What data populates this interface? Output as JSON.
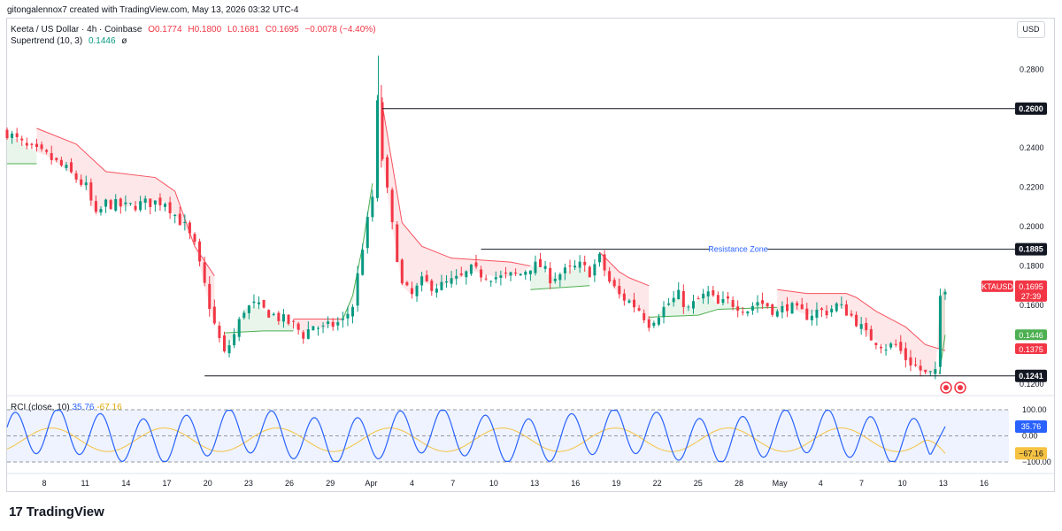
{
  "header": {
    "created_by": "gitongalennox7 created with TradingView.com, May 13, 2026 03:32 UTC-4"
  },
  "legend": {
    "symbol": "Keeta / US Dollar · 4h · Coinbase",
    "open": "O0.1774",
    "high": "H0.1800",
    "low": "L0.1681",
    "close": "C0.1695",
    "change": "−0.0078 (−4.40%)",
    "supertrend_label": "Supertrend (10, 3)",
    "supertrend_value": "0.1446",
    "supertrend_symbol": "ø"
  },
  "rci_legend": {
    "label": "RCI (close, 10)",
    "value1": "35.76",
    "value2": "-67.16"
  },
  "currency": "USD",
  "brand": {
    "logo_text": "17",
    "name": "TradingView"
  },
  "colors": {
    "up": "#089981",
    "down": "#f23645",
    "st_up": "#4caf50",
    "st_down": "#f7525f",
    "rci": "#2962ff",
    "rci_signal": "#f5c242"
  },
  "chart_data": {
    "type": "candlestick",
    "ylim": [
      0.115,
      0.295
    ],
    "price_ticks": [
      "0.2800",
      "0.2400",
      "0.2200",
      "0.2000",
      "0.1800",
      "0.1600",
      "0.1200"
    ],
    "price_tick_values": [
      0.28,
      0.24,
      0.22,
      0.2,
      0.18,
      0.16,
      0.12
    ],
    "x_ticks": [
      "8",
      "11",
      "14",
      "17",
      "20",
      "23",
      "26",
      "29",
      "Apr",
      "4",
      "7",
      "10",
      "13",
      "16",
      "19",
      "22",
      "25",
      "28",
      "May",
      "4",
      "7",
      "10",
      "13",
      "16"
    ],
    "horizontal_levels": [
      {
        "value": 0.26,
        "label": "0.2600",
        "start": 38
      },
      {
        "value": 0.1885,
        "label": "0.1885",
        "start": 48,
        "annotation": "Resistance Zone"
      },
      {
        "value": 0.1241,
        "label": "0.1241",
        "start": 20
      }
    ],
    "price_labels": [
      {
        "value": 0.1695,
        "label": "0.1695",
        "sublabel": "27:39",
        "tag": "KTAUSD",
        "color": "#f23645"
      },
      {
        "value": 0.1446,
        "label": "0.1446",
        "color": "#4caf50"
      },
      {
        "value": 0.1375,
        "label": "0.1375",
        "color": "#f23645"
      }
    ],
    "price_path": [
      [
        0,
        0.248
      ],
      [
        2,
        0.24
      ],
      [
        4,
        0.236
      ],
      [
        6,
        0.229
      ],
      [
        8,
        0.22
      ],
      [
        9,
        0.205
      ],
      [
        10,
        0.212
      ],
      [
        12,
        0.21
      ],
      [
        14,
        0.212
      ],
      [
        16,
        0.213
      ],
      [
        17,
        0.206
      ],
      [
        18,
        0.2
      ],
      [
        19,
        0.19
      ],
      [
        20,
        0.17
      ],
      [
        21,
        0.15
      ],
      [
        22,
        0.135
      ],
      [
        23,
        0.145
      ],
      [
        24,
        0.158
      ],
      [
        25,
        0.16
      ],
      [
        27,
        0.155
      ],
      [
        29,
        0.15
      ],
      [
        30,
        0.145
      ],
      [
        31,
        0.15
      ],
      [
        32,
        0.148
      ],
      [
        33,
        0.15
      ],
      [
        34,
        0.152
      ],
      [
        35,
        0.16
      ],
      [
        36,
        0.19
      ],
      [
        37,
        0.215
      ],
      [
        37.5,
        0.262
      ],
      [
        38,
        0.235
      ],
      [
        39,
        0.2
      ],
      [
        40,
        0.17
      ],
      [
        41,
        0.165
      ],
      [
        42,
        0.172
      ],
      [
        43,
        0.17
      ],
      [
        44,
        0.17
      ],
      [
        45,
        0.172
      ],
      [
        46,
        0.174
      ],
      [
        47,
        0.178
      ],
      [
        48,
        0.176
      ],
      [
        50,
        0.174
      ],
      [
        52,
        0.176
      ],
      [
        53,
        0.18
      ],
      [
        54,
        0.18
      ],
      [
        55,
        0.174
      ],
      [
        56,
        0.176
      ],
      [
        57,
        0.178
      ],
      [
        58,
        0.18
      ],
      [
        59,
        0.177
      ],
      [
        60,
        0.184
      ],
      [
        61,
        0.172
      ],
      [
        62,
        0.165
      ],
      [
        63,
        0.162
      ],
      [
        64,
        0.158
      ],
      [
        65,
        0.151
      ],
      [
        66,
        0.156
      ],
      [
        67,
        0.161
      ],
      [
        68,
        0.165
      ],
      [
        69,
        0.158
      ],
      [
        70,
        0.163
      ],
      [
        71,
        0.166
      ],
      [
        72,
        0.16
      ],
      [
        73,
        0.162
      ],
      [
        74,
        0.16
      ],
      [
        75,
        0.158
      ],
      [
        76,
        0.162
      ],
      [
        77,
        0.16
      ],
      [
        78,
        0.156
      ],
      [
        79,
        0.16
      ],
      [
        80,
        0.157
      ],
      [
        81,
        0.155
      ],
      [
        82,
        0.157
      ],
      [
        83,
        0.157
      ],
      [
        84,
        0.16
      ],
      [
        85,
        0.157
      ],
      [
        86,
        0.152
      ],
      [
        87,
        0.145
      ],
      [
        88,
        0.142
      ],
      [
        89,
        0.139
      ],
      [
        90,
        0.14
      ],
      [
        91,
        0.133
      ],
      [
        92,
        0.129
      ],
      [
        93,
        0.125
      ],
      [
        94,
        0.125
      ],
      [
        94.4,
        0.16
      ],
      [
        94.8,
        0.178
      ],
      [
        95,
        0.1695
      ]
    ],
    "supertrend": [
      {
        "dir": "up",
        "points": [
          [
            0,
            0.232
          ],
          [
            3,
            0.232
          ]
        ]
      },
      {
        "dir": "down",
        "points": [
          [
            3,
            0.25
          ],
          [
            7,
            0.242
          ],
          [
            10,
            0.228
          ],
          [
            15,
            0.225
          ],
          [
            17,
            0.218
          ],
          [
            19,
            0.19
          ],
          [
            21,
            0.175
          ]
        ]
      },
      {
        "dir": "up",
        "points": [
          [
            22,
            0.146
          ],
          [
            26,
            0.147
          ],
          [
            29,
            0.147
          ]
        ]
      },
      {
        "dir": "down",
        "points": [
          [
            29,
            0.153
          ],
          [
            34,
            0.153
          ]
        ]
      },
      {
        "dir": "up",
        "points": [
          [
            34,
            0.153
          ],
          [
            35,
            0.165
          ],
          [
            36,
            0.19
          ],
          [
            37,
            0.222
          ]
        ]
      },
      {
        "dir": "down",
        "points": [
          [
            38,
            0.262
          ],
          [
            39,
            0.232
          ],
          [
            40,
            0.202
          ],
          [
            42,
            0.19
          ],
          [
            45,
            0.184
          ],
          [
            51,
            0.182
          ],
          [
            53,
            0.18
          ]
        ]
      },
      {
        "dir": "up",
        "points": [
          [
            53,
            0.168
          ],
          [
            59,
            0.17
          ]
        ]
      },
      {
        "dir": "down",
        "points": [
          [
            60,
            0.187
          ],
          [
            62,
            0.177
          ],
          [
            63,
            0.174
          ],
          [
            65,
            0.17
          ]
        ]
      },
      {
        "dir": "up",
        "points": [
          [
            65,
            0.154
          ],
          [
            70,
            0.155
          ],
          [
            72,
            0.158
          ],
          [
            78,
            0.159
          ]
        ]
      },
      {
        "dir": "down",
        "points": [
          [
            78,
            0.168
          ],
          [
            81,
            0.166
          ],
          [
            85,
            0.166
          ],
          [
            86,
            0.164
          ],
          [
            88,
            0.157
          ],
          [
            91,
            0.149
          ],
          [
            93,
            0.14
          ],
          [
            95,
            0.137
          ]
        ]
      },
      {
        "dir": "up",
        "points": [
          [
            94.4,
            0.125
          ],
          [
            95,
            0.145
          ]
        ]
      }
    ],
    "rci": {
      "ylim": [
        -100,
        100
      ],
      "ticks": [
        "100.00",
        "0.00",
        "−100.00"
      ],
      "tick_values": [
        100,
        0,
        -100
      ],
      "value": 35.76,
      "signal_value": -67.16,
      "value_label": "35.76",
      "signal_label": "−67.16"
    }
  }
}
